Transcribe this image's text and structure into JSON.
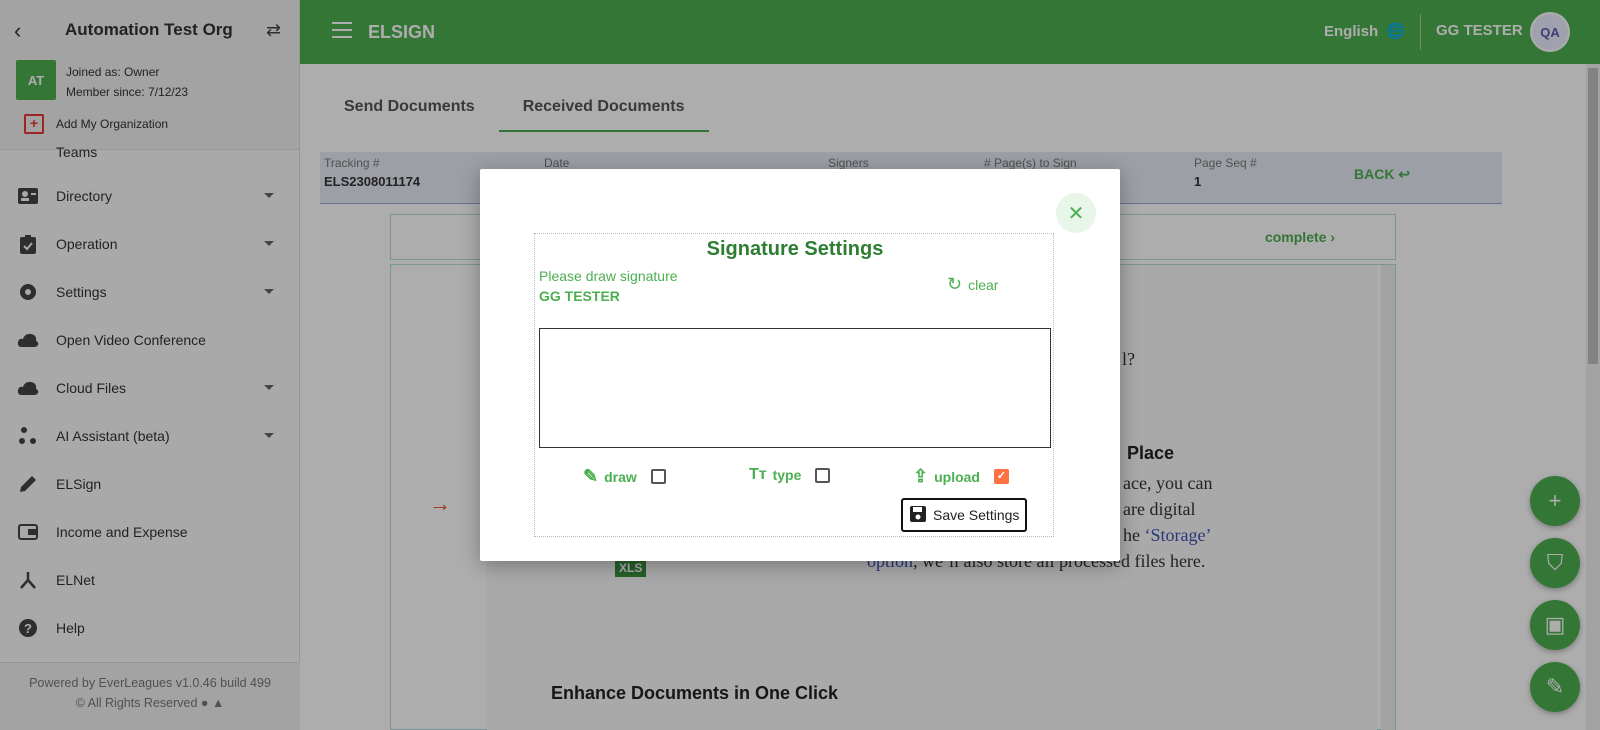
{
  "sidebar": {
    "org_name": "Automation Test Org",
    "avatar_initials": "AT",
    "joined_as": "Joined as: Owner",
    "member_since": "Member since: 7/12/23",
    "add_org": "Add My Organization",
    "teams_label": "Teams",
    "items": [
      {
        "label": "Directory",
        "icon": "contacts-icon",
        "has_caret": true
      },
      {
        "label": "Operation",
        "icon": "clipboard-check-icon",
        "has_caret": true
      },
      {
        "label": "Settings",
        "icon": "gear-icon",
        "has_caret": true
      },
      {
        "label": "Open Video Conference",
        "icon": "cloud-video-icon",
        "has_caret": false
      },
      {
        "label": "Cloud Files",
        "icon": "cloud-icon",
        "has_caret": true
      },
      {
        "label": "AI Assistant (beta)",
        "icon": "scatter-icon",
        "has_caret": true
      },
      {
        "label": "ELSign",
        "icon": "pencil-icon",
        "has_caret": false
      },
      {
        "label": "Income and Expense",
        "icon": "wallet-icon",
        "has_caret": false
      },
      {
        "label": "ELNet",
        "icon": "network-icon",
        "has_caret": false
      },
      {
        "label": "Help",
        "icon": "help-icon",
        "has_caret": false
      }
    ],
    "footer_powered": "Powered by EverLeagues v1.0.46 build 499",
    "footer_rights": "© All Rights Reserved"
  },
  "topbar": {
    "title": "ELSIGN",
    "language": "English",
    "user": "GG TESTER",
    "avatar_text": "QA"
  },
  "main": {
    "tabs": [
      "Send Documents",
      "Received Documents"
    ],
    "info": {
      "tracking_label": "Tracking #",
      "tracking_value": "ELS2308011174",
      "date_label": "Date",
      "signers_label": "Signers",
      "pages_label": "# Page(s) to Sign",
      "pageseq_label": "Page Seq #",
      "pageseq_value": "1",
      "back_label": "BACK"
    },
    "complete_label": "complete",
    "doc": {
      "question_tail": "l?",
      "place_heading_tail": "Place",
      "line1": "ace, you can",
      "line2": "are digital",
      "line3_prefix": "he ",
      "storage_link": "‘Storage’",
      "option_link": "option",
      "line4": ", we’ll also store all processed files here.",
      "enhance_heading": "Enhance Documents in One Click",
      "xls_badge": "XLS"
    }
  },
  "modal": {
    "title": "Signature Settings",
    "prompt": "Please draw signature",
    "signer": "GG TESTER",
    "clear_label": "clear",
    "options": [
      {
        "label": "draw",
        "checked": false
      },
      {
        "label": "type",
        "checked": false
      },
      {
        "label": "upload",
        "checked": true
      }
    ],
    "save_label": "Save Settings"
  },
  "colors": {
    "brand_green": "#4caf50",
    "title_green": "#2e7d32",
    "checkbox_checked": "#ff7043"
  }
}
